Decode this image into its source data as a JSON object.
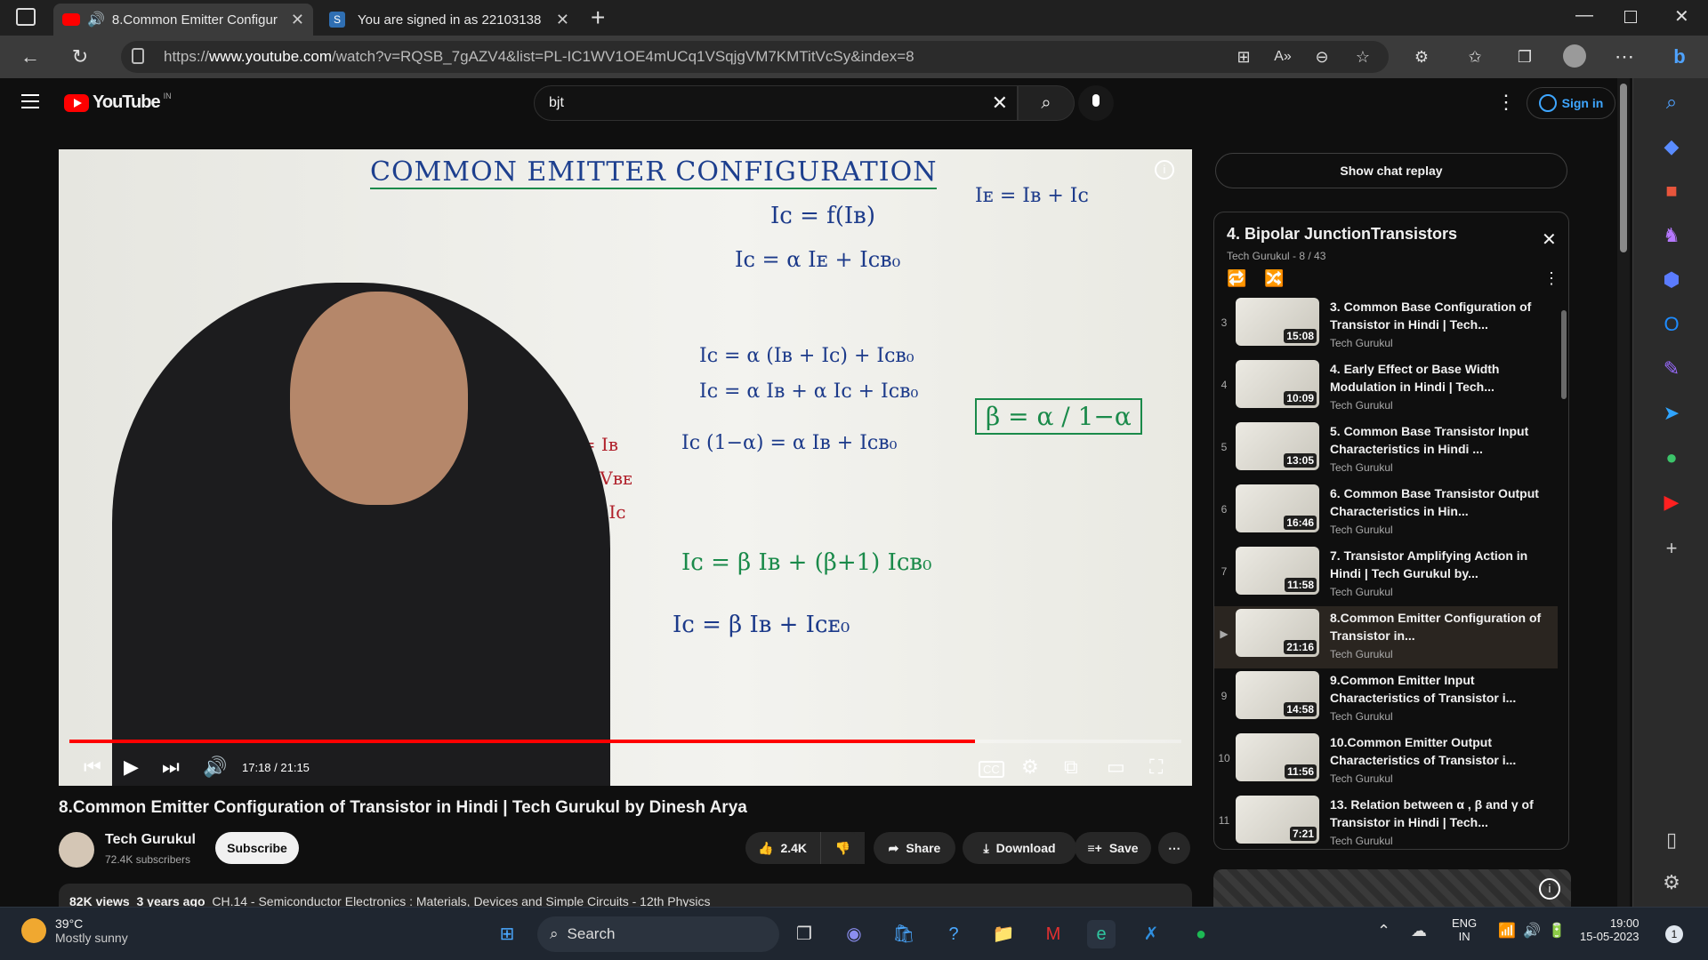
{
  "browser": {
    "tabs": [
      {
        "title": "8.Common Emitter Configur",
        "active": true
      },
      {
        "title": "You are signed in as 22103138",
        "active": false
      }
    ],
    "url_prefix": "https://",
    "url_host": "www.youtube.com",
    "url_path": "/watch?v=RQSB_7gAZV4&list=PL-IC1WV1OE4mUCq1VSqjgVM7KMTitVcSy&index=8"
  },
  "youtube": {
    "logo": "YouTube",
    "region": "IN",
    "search_value": "bjt",
    "sign_in": "Sign in"
  },
  "video": {
    "time": "17:18 / 21:15",
    "progress": 0.814,
    "title": "8.Common Emitter Configuration of Transistor in Hindi | Tech Gurukul by Dinesh Arya",
    "channel": "Tech Gurukul",
    "subscribers": "72.4K subscribers",
    "subscribe": "Subscribe",
    "likes": "2.4K",
    "share": "Share",
    "download": "Download",
    "save": "Save",
    "views": "82K views",
    "age": "3 years ago",
    "description": "CH.14 - Semiconductor Electronics : Materials, Devices and Simple Circuits - 12th Physics",
    "board_title": "COMMON EMITTER CONFIGURATION"
  },
  "chat": {
    "label": "Show chat replay"
  },
  "playlist": {
    "title": "4. Bipolar JunctionTransistors",
    "meta": "Tech Gurukul - 8 / 43",
    "items": [
      {
        "idx": "3",
        "title": "3. Common Base Configuration of Transistor in Hindi | Tech...",
        "channel": "Tech Gurukul",
        "duration": "15:08"
      },
      {
        "idx": "4",
        "title": "4. Early Effect or Base Width Modulation in Hindi | Tech...",
        "channel": "Tech Gurukul",
        "duration": "10:09"
      },
      {
        "idx": "5",
        "title": "5. Common Base Transistor Input Characteristics in Hindi ...",
        "channel": "Tech Gurukul",
        "duration": "13:05"
      },
      {
        "idx": "6",
        "title": "6. Common Base Transistor Output Characteristics in Hin...",
        "channel": "Tech Gurukul",
        "duration": "16:46"
      },
      {
        "idx": "7",
        "title": "7. Transistor Amplifying Action in Hindi | Tech Gurukul by...",
        "channel": "Tech Gurukul",
        "duration": "11:58"
      },
      {
        "idx": "▶",
        "title": "8.Common Emitter Configuration of Transistor in...",
        "channel": "Tech Gurukul",
        "duration": "21:16"
      },
      {
        "idx": "9",
        "title": "9.Common Emitter Input Characteristics of Transistor i...",
        "channel": "Tech Gurukul",
        "duration": "14:58"
      },
      {
        "idx": "10",
        "title": "10.Common Emitter Output Characteristics of Transistor i...",
        "channel": "Tech Gurukul",
        "duration": "11:56"
      },
      {
        "idx": "11",
        "title": "13. Relation between α , β and γ of Transistor in Hindi | Tech...",
        "channel": "Tech Gurukul",
        "duration": "7:21"
      }
    ]
  },
  "taskbar": {
    "temp": "39°C",
    "weather": "Mostly sunny",
    "search": "Search",
    "lang": "ENG",
    "lang_region": "IN",
    "time": "19:00",
    "date": "15-05-2023",
    "notif_count": "1"
  }
}
